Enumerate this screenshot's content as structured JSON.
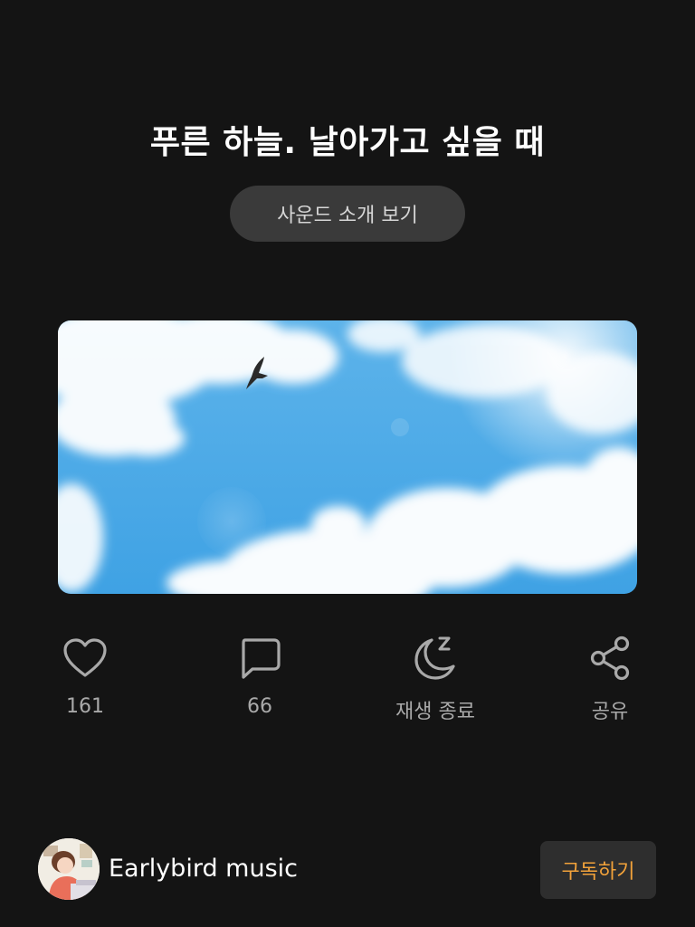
{
  "header": {
    "title": "푸른 하늘. 날아가고 싶을 때",
    "intro_button": "사운드 소개 보기"
  },
  "cover": {
    "sky_top": "#5db3ea",
    "sky_bottom": "#3fa2e4"
  },
  "actions": [
    {
      "icon": "heart-icon",
      "label": "161"
    },
    {
      "icon": "comment-icon",
      "label": "66"
    },
    {
      "icon": "moon-sleep-icon",
      "label": "재생 종료"
    },
    {
      "icon": "share-icon",
      "label": "공유"
    }
  ],
  "channel": {
    "name": "Earlybird music",
    "subscribe_label": "구독하기"
  },
  "colors": {
    "background": "#141414",
    "accent": "#f2a23a",
    "icon_gray": "#a9a9a9"
  }
}
